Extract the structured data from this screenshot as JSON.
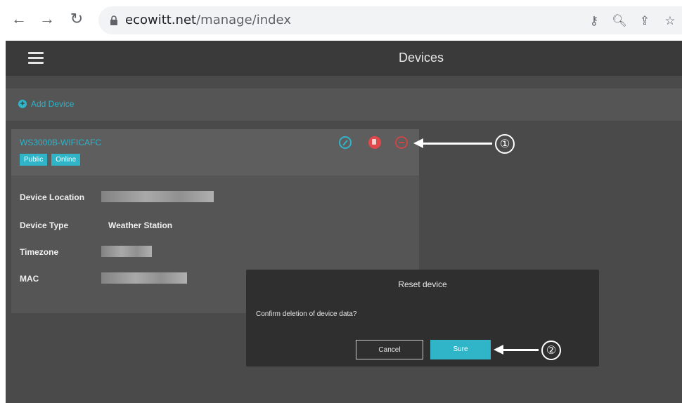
{
  "browser": {
    "url_host": "ecowitt.net",
    "url_path": "/manage/index",
    "icons": [
      "back-icon",
      "forward-icon",
      "reload-icon",
      "lock-icon",
      "key-icon",
      "zoom-icon",
      "share-icon",
      "bookmark-star-icon"
    ]
  },
  "app": {
    "title": "Devices",
    "add_device_label": "Add Device"
  },
  "device": {
    "name": "WS3000B-WIFICAFC",
    "badges": [
      "Public",
      "Online"
    ],
    "fields": {
      "location_label": "Device Location",
      "type_label": "Device Type",
      "type_value": "Weather Station",
      "timezone_label": "Timezone",
      "mac_label": "MAC"
    }
  },
  "modal": {
    "title": "Reset device",
    "message": "Confirm deletion of device data?",
    "cancel_label": "Cancel",
    "sure_label": "Sure"
  },
  "annotations": {
    "marker_1": "①",
    "marker_2": "②"
  },
  "colors": {
    "accent": "#2fb4c8",
    "danger": "#e0484c",
    "background": "#4a4a4a"
  }
}
